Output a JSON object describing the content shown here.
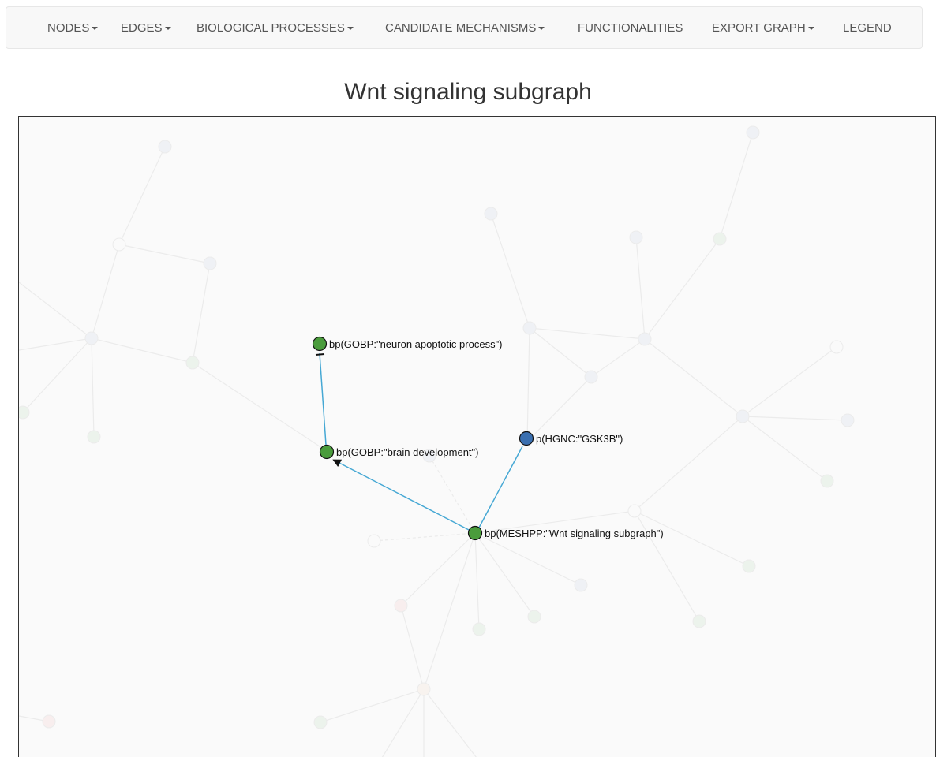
{
  "navbar": {
    "items": [
      {
        "label": "NODES",
        "dropdown": true
      },
      {
        "label": "EDGES",
        "dropdown": true
      },
      {
        "label": "BIOLOGICAL PROCESSES",
        "dropdown": true
      },
      {
        "label": "CANDIDATE MECHANISMS",
        "dropdown": true
      },
      {
        "label": "FUNCTIONALITIES",
        "dropdown": false
      },
      {
        "label": "EXPORT GRAPH",
        "dropdown": true
      },
      {
        "label": "LEGEND",
        "dropdown": false
      }
    ]
  },
  "page_title": "Wnt signaling subgraph",
  "graph": {
    "colors": {
      "bp_node": "#4a9c3c",
      "protein_node": "#3a6fb0",
      "edge_highlight": "#46a8d4",
      "faded_bp": "#90c48a",
      "faded_protein": "#a8b8d8",
      "faded_pathology": "#f0a0a0",
      "faded_other": "#f0c8a8"
    },
    "nodes": [
      {
        "id": "n1",
        "label": "bp(GOBP:\"neuron apoptotic process\")",
        "type": "bp"
      },
      {
        "id": "n2",
        "label": "bp(GOBP:\"brain development\")",
        "type": "bp"
      },
      {
        "id": "n3",
        "label": "p(HGNC:\"GSK3B\")",
        "type": "protein"
      },
      {
        "id": "n4",
        "label": "bp(MESHPP:\"Wnt signaling subgraph\")",
        "type": "bp"
      }
    ],
    "edges": [
      {
        "from": "n2",
        "to": "n1",
        "relation": "decreases"
      },
      {
        "from": "n4",
        "to": "n2",
        "relation": "increases"
      },
      {
        "from": "n4",
        "to": "n3",
        "relation": "association"
      }
    ]
  }
}
